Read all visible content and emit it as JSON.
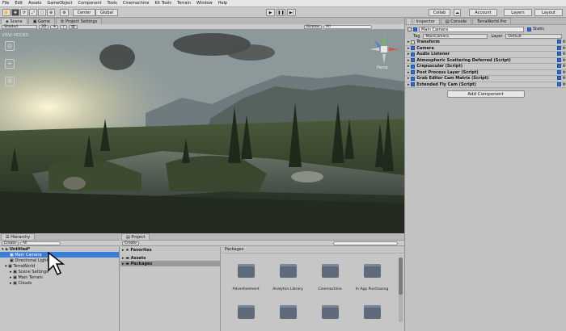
{
  "menu": [
    "File",
    "Edit",
    "Assets",
    "GameObject",
    "Component",
    "Tools",
    "Cinemachine",
    "Kit Tools",
    "Terrain",
    "Window",
    "Help"
  ],
  "toolbar": {
    "center": "Center",
    "global": "Global",
    "collab": "Collab",
    "account": "Account",
    "layers": "Layers",
    "layout": "Layout"
  },
  "scene_tabs": [
    "Scene",
    "Game",
    "Project Settings"
  ],
  "scene_bar": {
    "shaded": "Shaded",
    "mode_2d": "2D",
    "gizmos": "Gizmos",
    "search_prefix": "All"
  },
  "view_modes": "VIEW MODES",
  "gizmo": {
    "persp": "Persp"
  },
  "inspector": {
    "tabs": [
      "Inspector",
      "Console",
      "TerraWorld Pro"
    ],
    "object_name": "Main Camera",
    "static_label": "Static",
    "tag_label": "Tag",
    "tag_value": "MainCamera",
    "layer_label": "Layer",
    "layer_value": "Default",
    "components": [
      "Transform",
      "Camera",
      "Audio Listener",
      "Atmospheric Scattering Deferred (Script)",
      "Crepuscular (Script)",
      "Post Process Layer (Script)",
      "Grab Editor Cam Matrix (Script)",
      "Extended Fly Cam (Script)"
    ],
    "add_component": "Add Component"
  },
  "hierarchy": {
    "tab": "Hierarchy",
    "create": "Create",
    "search_prefix": "All",
    "scene": "Untitled*",
    "items": [
      "Main Camera",
      "Directional Light",
      "TerraWorld",
      "Scene Settings",
      "Main Terrain",
      "Clouds"
    ]
  },
  "project": {
    "tab": "Project",
    "create": "Create",
    "tree": [
      "Favorites",
      "Assets",
      "Packages"
    ],
    "breadcrumb": "Packages",
    "packages": [
      "Advertisement",
      "Analytics Library",
      "Cinemachine",
      "In App Purchasing",
      "",
      "",
      "",
      ""
    ]
  }
}
